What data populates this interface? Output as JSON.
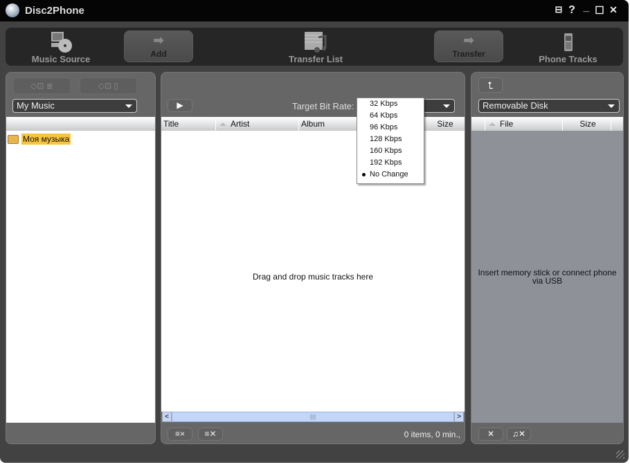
{
  "app": {
    "title": "Disc2Phone"
  },
  "titlebar": {
    "toolbox": "⊟",
    "help": "?",
    "minimize": "_",
    "maximize": "☐",
    "close": "✕"
  },
  "toolbar": {
    "music_source": "Music Source",
    "add": "Add",
    "transfer_list": "Transfer List",
    "transfer": "Transfer",
    "phone_tracks": "Phone Tracks"
  },
  "left": {
    "btn1": "◇⊡ ≣",
    "btn2": "◇⊡ ▯",
    "source_select": "My Music",
    "tree": [
      {
        "label": "Моя музыка",
        "selected": true
      }
    ]
  },
  "center": {
    "play": "▶",
    "bitrate_label": "Target Bit Rate:",
    "columns": [
      "Title",
      "Artist",
      "Album",
      "Size"
    ],
    "empty_text": "Drag and drop music tracks here",
    "status": "0 items, 0 min.,",
    "remove_btn": "≡×",
    "clear_btn": "≡✕",
    "bitrate_options": [
      "32 Kbps",
      "64 Kbps",
      "96 Kbps",
      "128 Kbps",
      "160 Kbps",
      "192 Kbps",
      "No Change"
    ],
    "bitrate_selected": "No Change"
  },
  "right": {
    "up_btn": "⮤",
    "device_select": "Removable Disk",
    "columns": [
      "File",
      "Size"
    ],
    "empty_text": "Insert memory stick or connect phone via USB",
    "delete_btn": "✕",
    "delete_track_btn": "♫✕"
  }
}
